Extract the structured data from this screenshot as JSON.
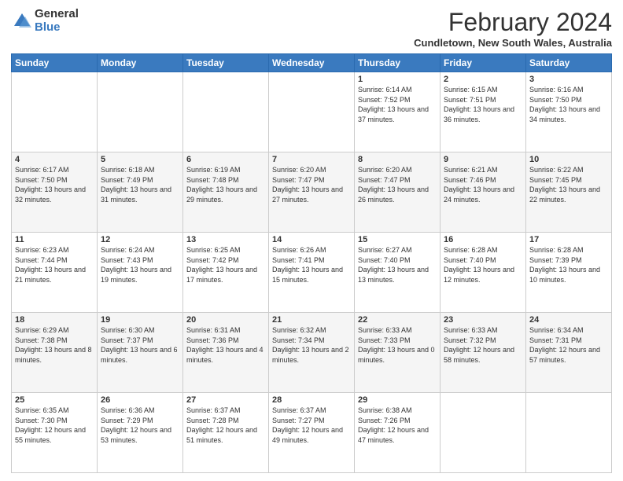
{
  "logo": {
    "general": "General",
    "blue": "Blue"
  },
  "header": {
    "title": "February 2024",
    "subtitle": "Cundletown, New South Wales, Australia"
  },
  "columns": [
    "Sunday",
    "Monday",
    "Tuesday",
    "Wednesday",
    "Thursday",
    "Friday",
    "Saturday"
  ],
  "weeks": [
    [
      {
        "day": "",
        "info": ""
      },
      {
        "day": "",
        "info": ""
      },
      {
        "day": "",
        "info": ""
      },
      {
        "day": "",
        "info": ""
      },
      {
        "day": "1",
        "info": "Sunrise: 6:14 AM\nSunset: 7:52 PM\nDaylight: 13 hours\nand 37 minutes."
      },
      {
        "day": "2",
        "info": "Sunrise: 6:15 AM\nSunset: 7:51 PM\nDaylight: 13 hours\nand 36 minutes."
      },
      {
        "day": "3",
        "info": "Sunrise: 6:16 AM\nSunset: 7:50 PM\nDaylight: 13 hours\nand 34 minutes."
      }
    ],
    [
      {
        "day": "4",
        "info": "Sunrise: 6:17 AM\nSunset: 7:50 PM\nDaylight: 13 hours\nand 32 minutes."
      },
      {
        "day": "5",
        "info": "Sunrise: 6:18 AM\nSunset: 7:49 PM\nDaylight: 13 hours\nand 31 minutes."
      },
      {
        "day": "6",
        "info": "Sunrise: 6:19 AM\nSunset: 7:48 PM\nDaylight: 13 hours\nand 29 minutes."
      },
      {
        "day": "7",
        "info": "Sunrise: 6:20 AM\nSunset: 7:47 PM\nDaylight: 13 hours\nand 27 minutes."
      },
      {
        "day": "8",
        "info": "Sunrise: 6:20 AM\nSunset: 7:47 PM\nDaylight: 13 hours\nand 26 minutes."
      },
      {
        "day": "9",
        "info": "Sunrise: 6:21 AM\nSunset: 7:46 PM\nDaylight: 13 hours\nand 24 minutes."
      },
      {
        "day": "10",
        "info": "Sunrise: 6:22 AM\nSunset: 7:45 PM\nDaylight: 13 hours\nand 22 minutes."
      }
    ],
    [
      {
        "day": "11",
        "info": "Sunrise: 6:23 AM\nSunset: 7:44 PM\nDaylight: 13 hours\nand 21 minutes."
      },
      {
        "day": "12",
        "info": "Sunrise: 6:24 AM\nSunset: 7:43 PM\nDaylight: 13 hours\nand 19 minutes."
      },
      {
        "day": "13",
        "info": "Sunrise: 6:25 AM\nSunset: 7:42 PM\nDaylight: 13 hours\nand 17 minutes."
      },
      {
        "day": "14",
        "info": "Sunrise: 6:26 AM\nSunset: 7:41 PM\nDaylight: 13 hours\nand 15 minutes."
      },
      {
        "day": "15",
        "info": "Sunrise: 6:27 AM\nSunset: 7:40 PM\nDaylight: 13 hours\nand 13 minutes."
      },
      {
        "day": "16",
        "info": "Sunrise: 6:28 AM\nSunset: 7:40 PM\nDaylight: 13 hours\nand 12 minutes."
      },
      {
        "day": "17",
        "info": "Sunrise: 6:28 AM\nSunset: 7:39 PM\nDaylight: 13 hours\nand 10 minutes."
      }
    ],
    [
      {
        "day": "18",
        "info": "Sunrise: 6:29 AM\nSunset: 7:38 PM\nDaylight: 13 hours\nand 8 minutes."
      },
      {
        "day": "19",
        "info": "Sunrise: 6:30 AM\nSunset: 7:37 PM\nDaylight: 13 hours\nand 6 minutes."
      },
      {
        "day": "20",
        "info": "Sunrise: 6:31 AM\nSunset: 7:36 PM\nDaylight: 13 hours\nand 4 minutes."
      },
      {
        "day": "21",
        "info": "Sunrise: 6:32 AM\nSunset: 7:34 PM\nDaylight: 13 hours\nand 2 minutes."
      },
      {
        "day": "22",
        "info": "Sunrise: 6:33 AM\nSunset: 7:33 PM\nDaylight: 13 hours\nand 0 minutes."
      },
      {
        "day": "23",
        "info": "Sunrise: 6:33 AM\nSunset: 7:32 PM\nDaylight: 12 hours\nand 58 minutes."
      },
      {
        "day": "24",
        "info": "Sunrise: 6:34 AM\nSunset: 7:31 PM\nDaylight: 12 hours\nand 57 minutes."
      }
    ],
    [
      {
        "day": "25",
        "info": "Sunrise: 6:35 AM\nSunset: 7:30 PM\nDaylight: 12 hours\nand 55 minutes."
      },
      {
        "day": "26",
        "info": "Sunrise: 6:36 AM\nSunset: 7:29 PM\nDaylight: 12 hours\nand 53 minutes."
      },
      {
        "day": "27",
        "info": "Sunrise: 6:37 AM\nSunset: 7:28 PM\nDaylight: 12 hours\nand 51 minutes."
      },
      {
        "day": "28",
        "info": "Sunrise: 6:37 AM\nSunset: 7:27 PM\nDaylight: 12 hours\nand 49 minutes."
      },
      {
        "day": "29",
        "info": "Sunrise: 6:38 AM\nSunset: 7:26 PM\nDaylight: 12 hours\nand 47 minutes."
      },
      {
        "day": "",
        "info": ""
      },
      {
        "day": "",
        "info": ""
      }
    ]
  ]
}
